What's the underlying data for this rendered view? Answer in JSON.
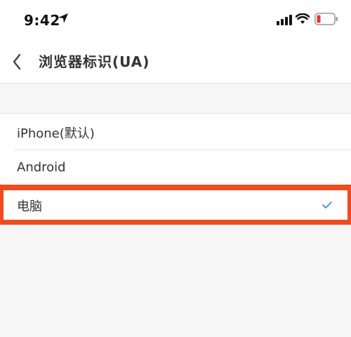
{
  "status_bar": {
    "time": "9:42",
    "icons": [
      "location-arrow-icon",
      "signal-icon",
      "wifi-icon",
      "battery-low-icon"
    ],
    "battery_color": "#e5382b"
  },
  "nav": {
    "back_icon": "chevron-left-icon",
    "title": "浏览器标识(UA)"
  },
  "options": [
    {
      "label": "iPhone(默认)",
      "selected": false
    },
    {
      "label": "Android",
      "selected": false
    },
    {
      "label": "电脑",
      "selected": true
    }
  ],
  "colors": {
    "highlight": "#f24a1f",
    "check": "#3b8fe0",
    "background": "#f6f6f6"
  }
}
